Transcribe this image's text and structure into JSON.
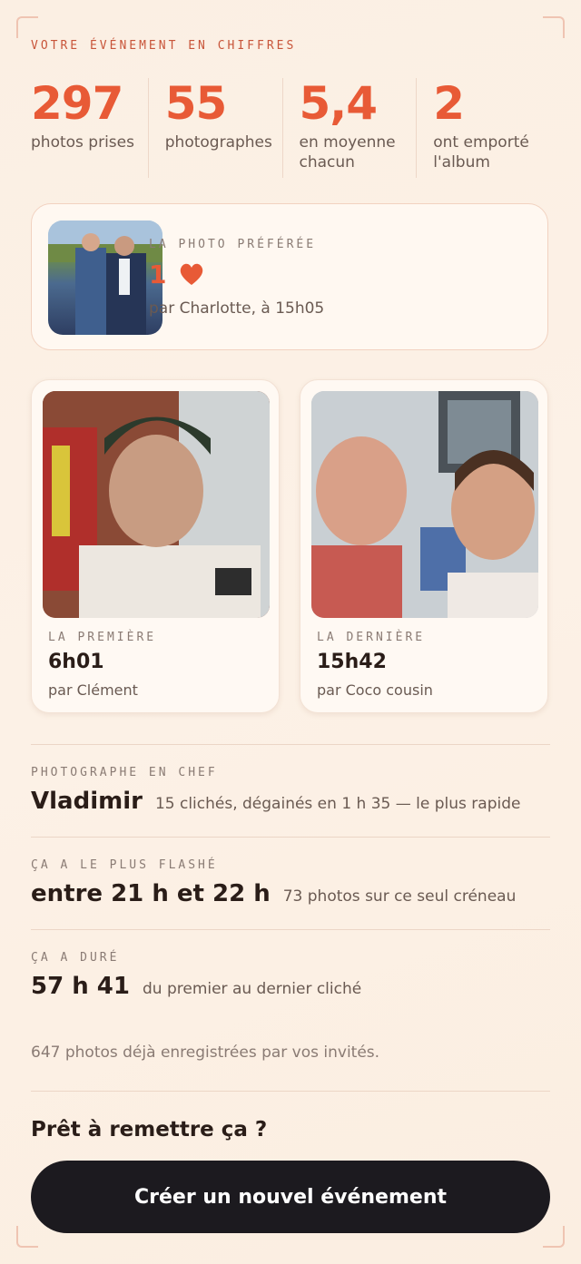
{
  "header": {
    "eyebrow": "VOTRE ÉVÉNEMENT EN CHIFFRES"
  },
  "stats": [
    {
      "value": "297",
      "label": "photos prises"
    },
    {
      "value": "55",
      "label": "photographes"
    },
    {
      "value": "5,4",
      "label": "en moyenne chacun"
    },
    {
      "value": "2",
      "label": "ont emporté l'album"
    }
  ],
  "favorite": {
    "eyebrow": "LA PHOTO PRÉFÉRÉE",
    "count": "1",
    "icon": "heart-icon",
    "by": "par Charlotte, à 15h05"
  },
  "first_photo": {
    "eyebrow": "LA PREMIÈRE",
    "time": "6h01",
    "by": "par Clément"
  },
  "last_photo": {
    "eyebrow": "LA DERNIÈRE",
    "time": "15h42",
    "by": "par Coco cousin"
  },
  "chief": {
    "eyebrow": "PHOTOGRAPHE EN CHEF",
    "name": "Vladimir",
    "detail": "15 clichés, dégainés en 1 h 35 — le plus rapide"
  },
  "peak": {
    "eyebrow": "ÇA A LE PLUS FLASHÉ",
    "value": "entre 21 h et 22 h",
    "detail": "73 photos sur ce seul créneau"
  },
  "duration": {
    "eyebrow": "ÇA A DURÉ",
    "value": "57 h 41",
    "detail": "du premier au dernier cliché"
  },
  "total_note": "647 photos déjà enregistrées par vos invités.",
  "cta": {
    "title": "Prêt à remettre ça ?",
    "button_label": "Créer un nouvel événement"
  },
  "colors": {
    "accent": "#e85a36",
    "eyebrow_accent": "#c8553a",
    "button_bg": "#1c1a1f"
  }
}
